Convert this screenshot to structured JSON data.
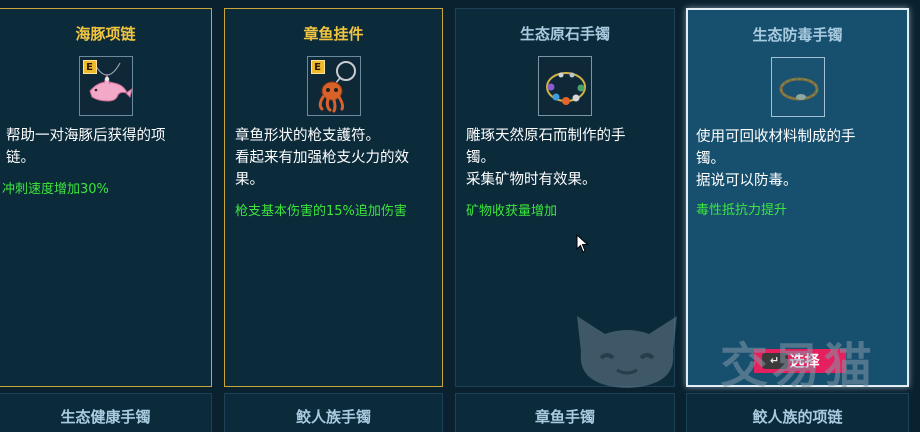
{
  "cards": [
    {
      "title": "海豚项链",
      "rarity_badge": "E",
      "icon": "dolphin-necklace-icon",
      "description": "帮助一对海豚后获得的项\n链。",
      "effect": "冲刺速度增加30%"
    },
    {
      "title": "章鱼挂件",
      "rarity_badge": "E",
      "icon": "octopus-charm-icon",
      "description": "章鱼形状的枪支護符。\n看起来有加强枪支火力的效\n果。",
      "effect": "枪支基本伤害的15%追加伤害"
    },
    {
      "title": "生态原石手镯",
      "icon": "gemstone-bracelet-icon",
      "description": "雕琢天然原石而制作的手\n镯。\n采集矿物时有效果。",
      "effect": "矿物收获量增加"
    },
    {
      "title": "生态防毒手镯",
      "icon": "antidote-bracelet-icon",
      "description": "使用可回收材料制成的手\n镯。\n据说可以防毒。",
      "effect": "毒性抵抗力提升",
      "select_key": "↵",
      "select_label": "选择"
    }
  ],
  "bottom_row": [
    "生态健康手镯",
    "鲛人族手镯",
    "章鱼手镯",
    "鲛人族的项链"
  ],
  "watermark": {
    "text": "交易猫",
    "icon": "cat-face-logo"
  },
  "colors": {
    "rare_border": "#c9a63a",
    "rare_title": "#f1c53f",
    "effect_text": "#3ce63c",
    "select_button": "#e6205e",
    "selected_card_bg": "#17506f"
  }
}
